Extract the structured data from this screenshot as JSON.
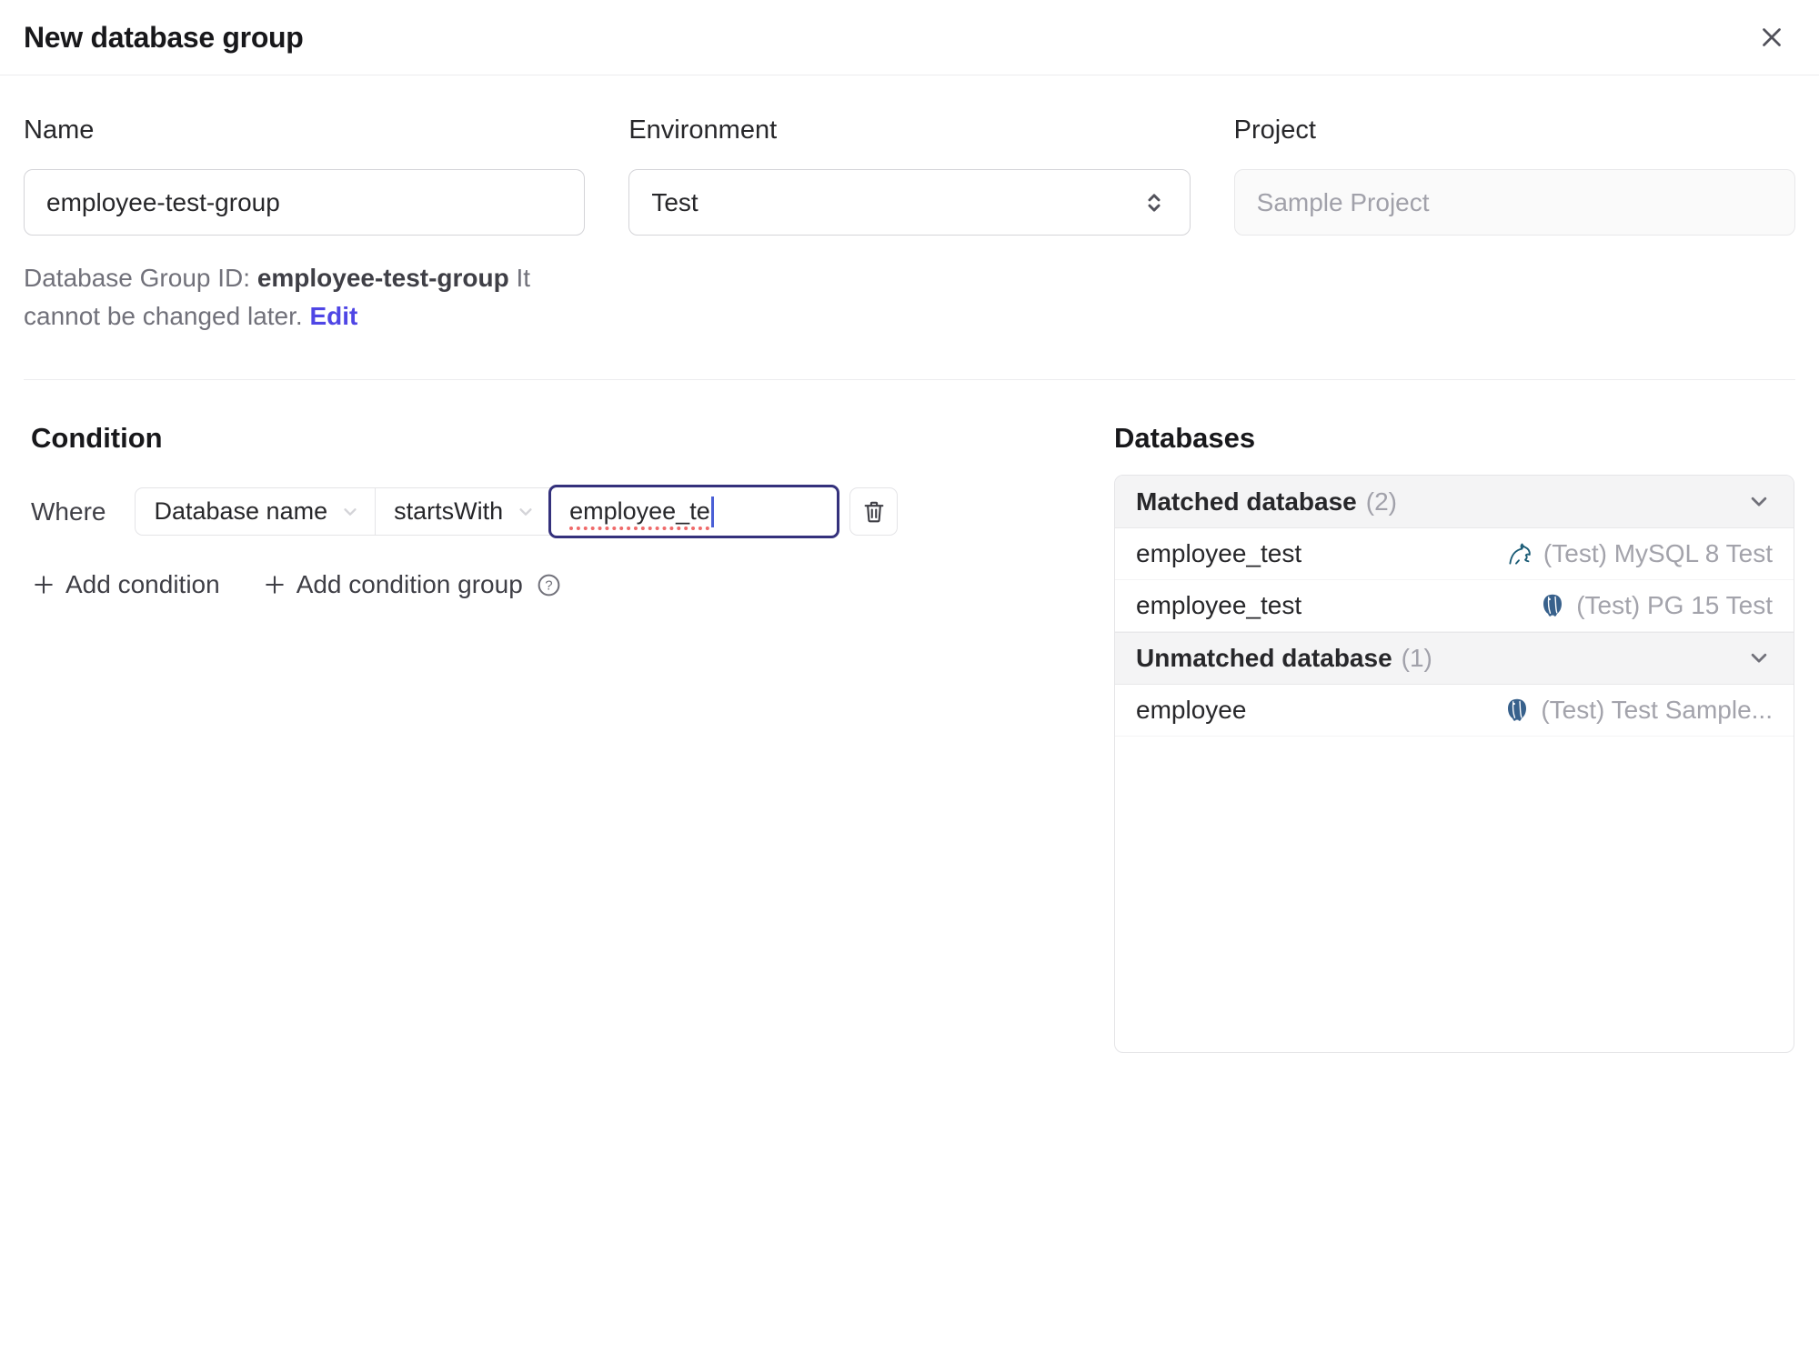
{
  "dialog": {
    "title": "New database group"
  },
  "form": {
    "name": {
      "label": "Name",
      "value": "employee-test-group"
    },
    "environment": {
      "label": "Environment",
      "value": "Test"
    },
    "project": {
      "label": "Project",
      "value": "Sample Project",
      "disabled": true
    },
    "id_help": {
      "prefix": "Database Group ID: ",
      "id": "employee-test-group",
      "suffix": " It cannot be changed later. ",
      "edit_label": "Edit"
    }
  },
  "condition": {
    "heading": "Condition",
    "where_label": "Where",
    "field_selected": "Database name",
    "operator_selected": "startsWith",
    "value": "employee_te",
    "add_condition_label": "Add condition",
    "add_condition_group_label": "Add condition group"
  },
  "databases": {
    "heading": "Databases",
    "groups": [
      {
        "title": "Matched database",
        "count_label": "(2)",
        "rows": [
          {
            "name": "employee_test",
            "engine": "mysql",
            "instance": "(Test) MySQL 8 Test"
          },
          {
            "name": "employee_test",
            "engine": "postgres",
            "instance": "(Test) PG 15 Test"
          }
        ]
      },
      {
        "title": "Unmatched database",
        "count_label": "(1)",
        "rows": [
          {
            "name": "employee",
            "engine": "postgres",
            "instance": "(Test) Test Sample..."
          }
        ]
      }
    ]
  },
  "colors": {
    "accent_link": "#4f46e5",
    "focused_input_border": "#34317c",
    "spellcheck_underline": "#ef6a6a",
    "panel_header_bg": "#f4f4f5",
    "border": "#e4e4e7",
    "muted_text": "#a1a1aa",
    "mysql_icon": "#1b5c76",
    "postgres_icon": "#38618c"
  }
}
